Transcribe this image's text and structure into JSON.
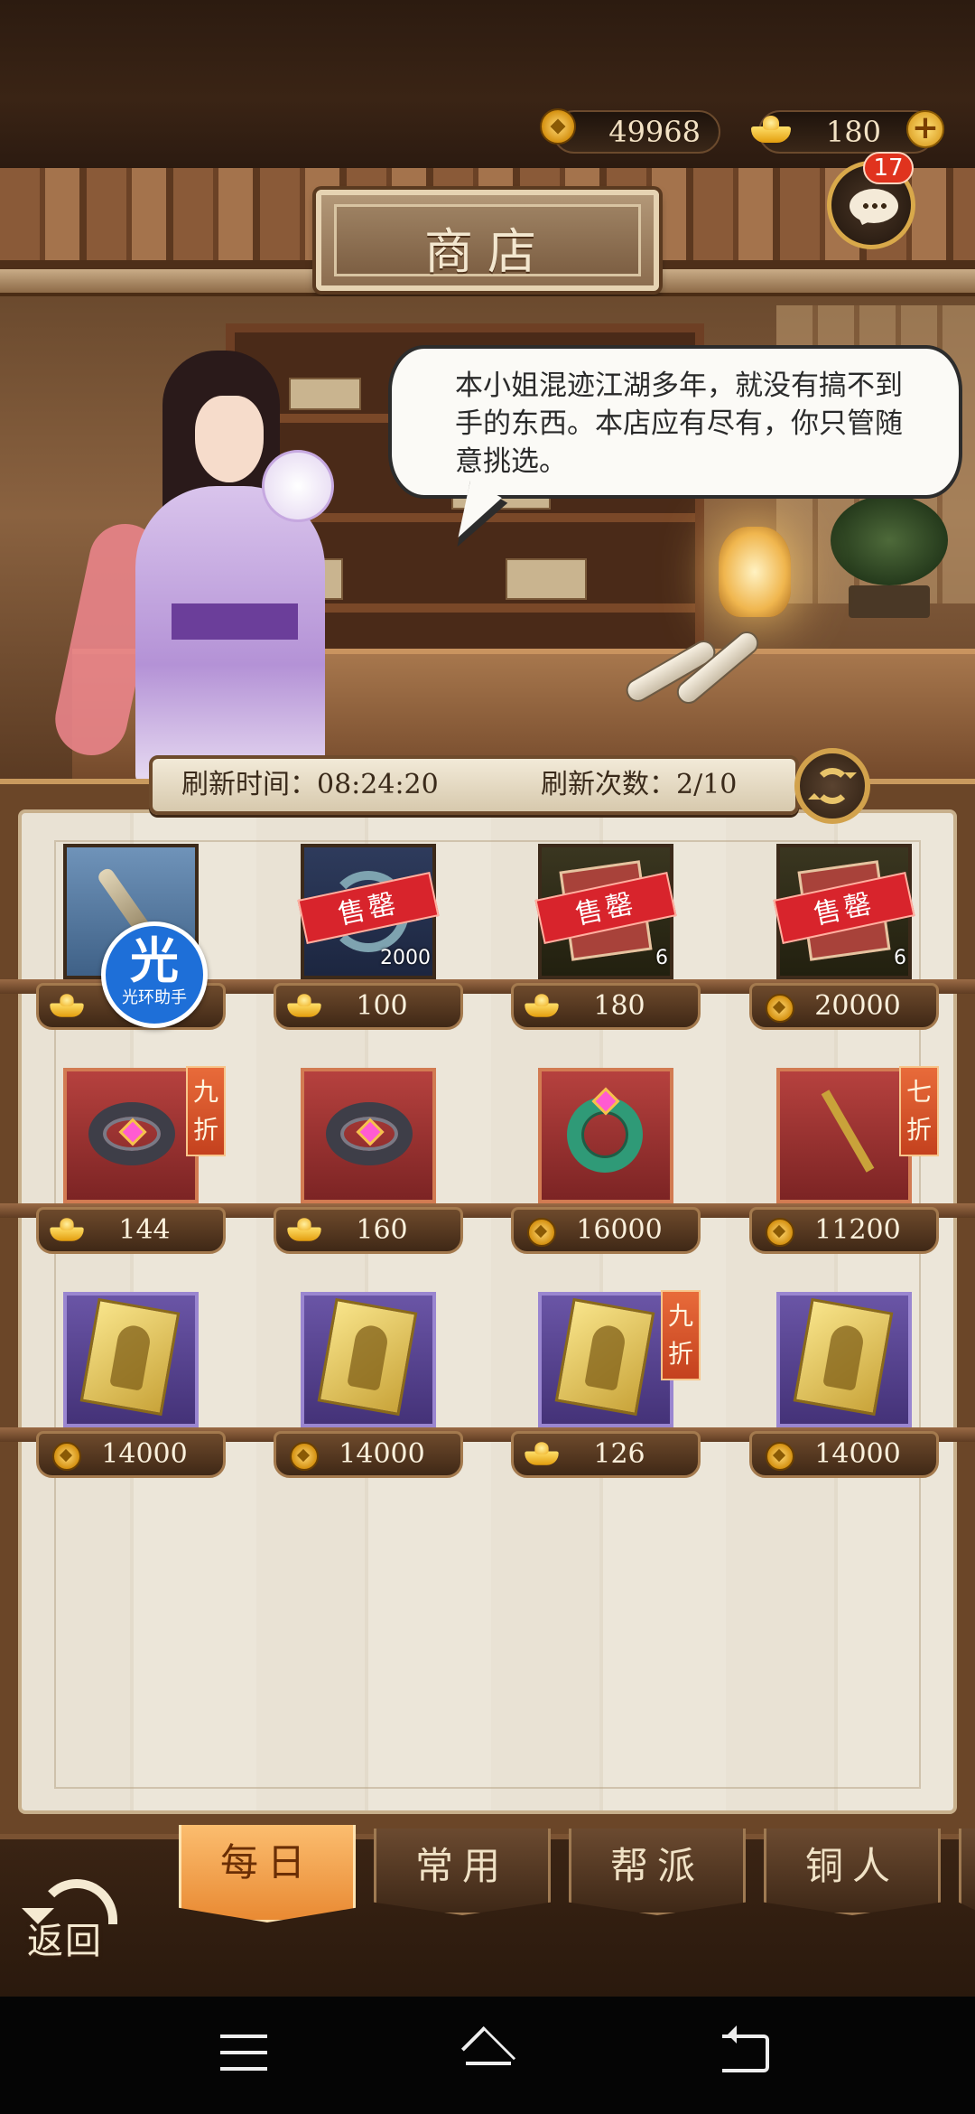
{
  "currency": {
    "copper": "49968",
    "gold": "180",
    "add_symbol": "+"
  },
  "header": {
    "title": "商店",
    "chat_badge": "17"
  },
  "speech": "本小姐混迹江湖多年，就没有搞不到手的东西。本店应有尽有，你只管随意挑选。",
  "refresh": {
    "time_label": "刷新时间：08:24:20",
    "count_label": "刷新次数：2/10"
  },
  "items": [
    {
      "art": "whip",
      "frame": "blue",
      "sold": "",
      "qty": "",
      "currency": "gold-ingot",
      "price": "",
      "discount": ""
    },
    {
      "art": "swirl",
      "frame": "navy",
      "sold": "售罄",
      "qty": "2000",
      "currency": "gold-ingot",
      "price": "100",
      "discount": ""
    },
    {
      "art": "pages",
      "frame": "dark",
      "sold": "售罄",
      "qty": "6",
      "currency": "gold-ingot",
      "price": "180",
      "discount": ""
    },
    {
      "art": "pages",
      "frame": "dark",
      "sold": "售罄",
      "qty": "6",
      "currency": "copper-coin",
      "price": "20000",
      "discount": ""
    },
    {
      "art": "bracelet",
      "frame": "red",
      "sold": "",
      "qty": "",
      "currency": "gold-ingot",
      "price": "144",
      "discount": "九折"
    },
    {
      "art": "bracelet",
      "frame": "red",
      "sold": "",
      "qty": "",
      "currency": "gold-ingot",
      "price": "160",
      "discount": ""
    },
    {
      "art": "jade",
      "frame": "red",
      "sold": "",
      "qty": "",
      "currency": "copper-coin",
      "price": "16000",
      "discount": ""
    },
    {
      "art": "hairpin",
      "frame": "red",
      "sold": "",
      "qty": "",
      "currency": "copper-coin",
      "price": "11200",
      "discount": "七折"
    },
    {
      "art": "card",
      "frame": "purple",
      "sold": "",
      "qty": "",
      "currency": "copper-coin",
      "price": "14000",
      "discount": ""
    },
    {
      "art": "card",
      "frame": "purple",
      "sold": "",
      "qty": "",
      "currency": "copper-coin",
      "price": "14000",
      "discount": ""
    },
    {
      "art": "card",
      "frame": "purple",
      "sold": "",
      "qty": "",
      "currency": "gold-ingot",
      "price": "126",
      "discount": "九折"
    },
    {
      "art": "card",
      "frame": "purple",
      "sold": "",
      "qty": "",
      "currency": "copper-coin",
      "price": "14000",
      "discount": ""
    }
  ],
  "helper": {
    "glyph": "光",
    "label": "光环助手"
  },
  "tabs": [
    {
      "label": "每日",
      "active": true
    },
    {
      "label": "常用",
      "active": false
    },
    {
      "label": "帮派",
      "active": false
    },
    {
      "label": "铜人",
      "active": false
    }
  ],
  "back_label": "返回",
  "colors": {
    "active_tab": "#e98a33",
    "sold_banner": "#d8242c",
    "discount_tag": "#c4411e",
    "badge": "#e0331e"
  }
}
